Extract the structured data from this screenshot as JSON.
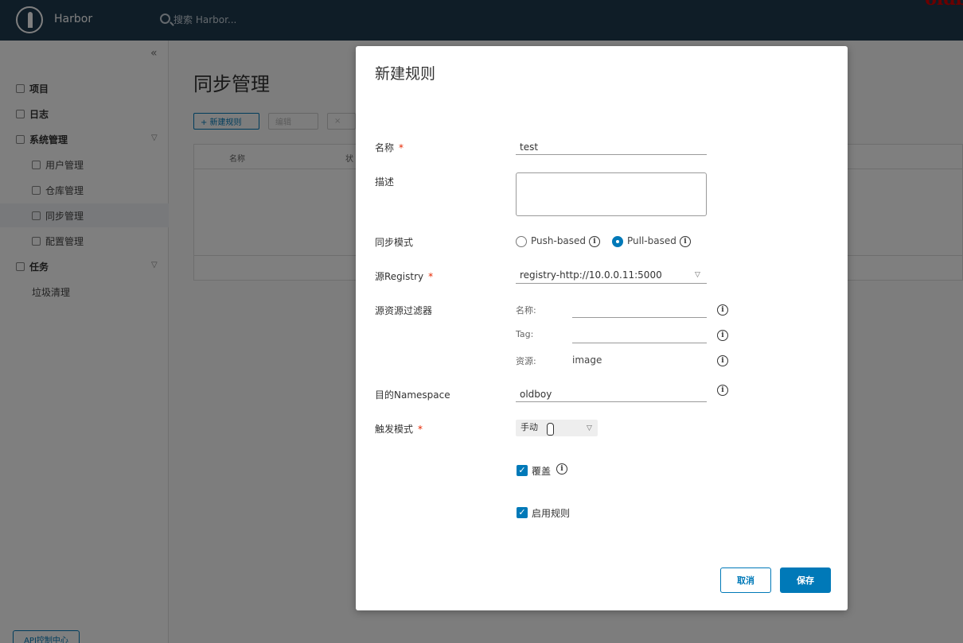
{
  "header": {
    "brand": "Harbor",
    "search_placeholder": "搜索 Harbor...",
    "watermark": "oldb"
  },
  "sidebar": {
    "items": [
      {
        "label": "项目",
        "level": 1
      },
      {
        "label": "日志",
        "level": 1
      },
      {
        "label": "系统管理",
        "level": 1
      },
      {
        "label": "用户管理",
        "level": 2
      },
      {
        "label": "仓库管理",
        "level": 2
      },
      {
        "label": "同步管理",
        "level": 2
      },
      {
        "label": "配置管理",
        "level": 2
      },
      {
        "label": "任务",
        "level": 1
      },
      {
        "label": "垃圾清理",
        "level": 2
      }
    ],
    "api_button": "API控制中心"
  },
  "page": {
    "title": "同步管理",
    "toolbar": {
      "new_rule": "+ 新建规则",
      "edit": "编辑",
      "delete": "×"
    },
    "grid_headers": [
      "名称",
      "状"
    ]
  },
  "modal": {
    "title": "新建规则",
    "name_label": "名称",
    "name_value": "test",
    "desc_label": "描述",
    "desc_value": "",
    "mode_label": "同步模式",
    "mode_push": "Push-based",
    "mode_pull": "Pull-based",
    "mode_selected": "pull",
    "registry_label": "源Registry",
    "registry_value": "registry-http://10.0.0.11:5000",
    "filter_label": "源资源过滤器",
    "filter_name_label": "名称:",
    "filter_name_value": "",
    "filter_tag_label": "Tag:",
    "filter_tag_value": "",
    "filter_resource_label": "资源:",
    "filter_resource_value": "image",
    "ns_label": "目的Namespace",
    "ns_value": "oldboy",
    "trigger_label": "触发模式",
    "trigger_value": "手动",
    "override_label": "覆盖",
    "override_checked": true,
    "enable_label": "启用规则",
    "enable_checked": true,
    "cancel": "取消",
    "save": "保存",
    "required_mark": "*",
    "info_glyph": "i",
    "check_glyph": "✓"
  },
  "colors": {
    "primary": "#0079b8",
    "header": "#1f3a4f",
    "required": "#e62700"
  }
}
